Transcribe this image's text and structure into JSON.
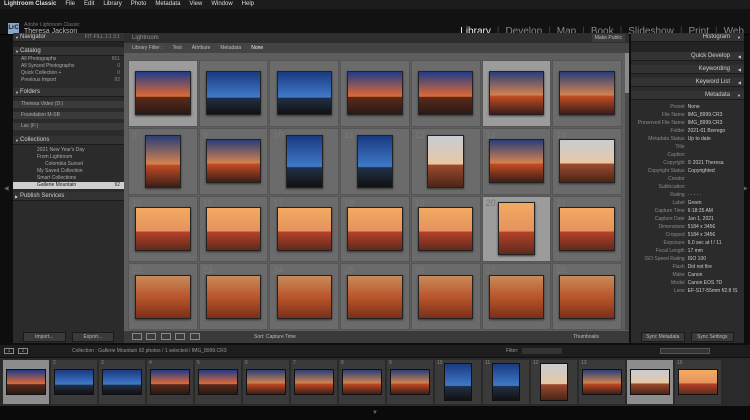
{
  "menubar": {
    "app": "Lightroom Classic",
    "items": [
      "File",
      "Edit",
      "Library",
      "Photo",
      "Metadata",
      "View",
      "Window",
      "Help"
    ]
  },
  "identity": {
    "logo": "LrC",
    "brand": "Adobe Lightroom Classic",
    "user": "Theresa Jackson"
  },
  "modules": [
    "Library",
    "Develop",
    "Map",
    "Book",
    "Slideshow",
    "Print",
    "Web"
  ],
  "active_module": "Library",
  "left_panel": {
    "navigator": {
      "title": "Navigator",
      "zoom": "FIT  FILL  1:1  3:1"
    },
    "catalog": {
      "title": "Catalog",
      "items": [
        {
          "label": "All Photographs",
          "count": "661"
        },
        {
          "label": "All Synced Photographs",
          "count": "0"
        },
        {
          "label": "Quick Collection +",
          "count": "0"
        },
        {
          "label": "Previous Import",
          "count": "92"
        }
      ]
    },
    "folders": {
      "title": "Folders",
      "items": [
        {
          "label": "Theresa Video (D:)",
          "count": ""
        },
        {
          "label": "Foundation M-SB",
          "count": ""
        },
        {
          "label": "Lac (F:)",
          "count": ""
        }
      ]
    },
    "collections": {
      "title": "Collections",
      "items": [
        {
          "label": "2021 New Year's Day",
          "count": ""
        },
        {
          "label": "From Lightroom",
          "count": ""
        },
        {
          "label": "Colombia Sunset",
          "count": ""
        },
        {
          "label": "My Saved Collection",
          "count": ""
        },
        {
          "label": "Smart Collections",
          "count": ""
        },
        {
          "label": "Gallerie Mountain",
          "count": "92"
        }
      ]
    },
    "publish": {
      "title": "Publish Services"
    },
    "import_label": "Import...",
    "export_label": "Export..."
  },
  "center": {
    "title": "Lightroom",
    "make_public": "Make Public",
    "filters": [
      "Library Filter :",
      "Text",
      "Attribute",
      "Metadata",
      "None"
    ],
    "filter_active": "None",
    "sort_label": "Sort:",
    "sort_value": "Capture Time",
    "thumbnails_label": "Thumbnails",
    "cells": [
      {
        "n": "",
        "style": "p-dusk",
        "sel": true
      },
      {
        "n": "",
        "style": "p-blue"
      },
      {
        "n": "",
        "style": "p-blue"
      },
      {
        "n": "",
        "style": "p-dusk"
      },
      {
        "n": "",
        "style": "p-dusk"
      },
      {
        "n": "",
        "style": "p-sunset",
        "sel": true
      },
      {
        "n": "",
        "style": "p-sunset"
      },
      {
        "n": "8",
        "style": "p-sunset",
        "tall": true
      },
      {
        "n": "9",
        "style": "p-sunset"
      },
      {
        "n": "10",
        "style": "p-blue",
        "tall": true
      },
      {
        "n": "11",
        "style": "p-blue",
        "tall": true
      },
      {
        "n": "12",
        "style": "p-pale",
        "tall": true
      },
      {
        "n": "13",
        "style": "p-sunset"
      },
      {
        "n": "14",
        "style": "p-pale"
      },
      {
        "n": "15",
        "style": "p-warm"
      },
      {
        "n": "16",
        "style": "p-warm"
      },
      {
        "n": "17",
        "style": "p-warm"
      },
      {
        "n": "18",
        "style": "p-warm"
      },
      {
        "n": "19",
        "style": "p-warm"
      },
      {
        "n": "20",
        "style": "p-warm",
        "tall": true,
        "sel": true
      },
      {
        "n": "21",
        "style": "p-warm"
      },
      {
        "n": "22",
        "style": "p-rust"
      },
      {
        "n": "23",
        "style": "p-rust"
      },
      {
        "n": "24",
        "style": "p-rust"
      },
      {
        "n": "25",
        "style": "p-rust"
      },
      {
        "n": "26",
        "style": "p-rust"
      },
      {
        "n": "27",
        "style": "p-rust"
      },
      {
        "n": "28",
        "style": "p-rust"
      }
    ]
  },
  "right_panel": {
    "histogram": "Histogram",
    "quick_develop": "Quick Develop",
    "keywording": "Keywording",
    "keyword_list": "Keyword List",
    "metadata": "Metadata",
    "preset_label": "Preset",
    "preset_value": "None",
    "rows": [
      {
        "k": "File Name",
        "v": "IMG_8999.CR3"
      },
      {
        "k": "Preserved File Name",
        "v": "IMG_8999.CR3"
      },
      {
        "k": "Folder",
        "v": "2021-01 Borrego"
      },
      {
        "k": "Metadata Status",
        "v": "Up to date"
      },
      {
        "k": "Title",
        "v": ""
      },
      {
        "k": "Caption",
        "v": ""
      },
      {
        "k": "Copyright",
        "v": "© 2021 Theresa"
      },
      {
        "k": "Copyright Status",
        "v": "Copyrighted"
      },
      {
        "k": "Creator",
        "v": ""
      },
      {
        "k": "Sublocation",
        "v": ""
      },
      {
        "k": "Rating",
        "v": "· · · · ·"
      },
      {
        "k": "Label",
        "v": "Green"
      },
      {
        "k": "Capture Time",
        "v": "6:18:35 AM"
      },
      {
        "k": "Capture Date",
        "v": "Jan 1, 2021"
      },
      {
        "k": "Dimensions",
        "v": "5184 x 3456"
      },
      {
        "k": "Cropped",
        "v": "5184 x 3456"
      },
      {
        "k": "Exposure",
        "v": "6.0 sec at f / 11"
      },
      {
        "k": "Focal Length",
        "v": "17 mm"
      },
      {
        "k": "ISO Speed Rating",
        "v": "ISO 100"
      },
      {
        "k": "Flash",
        "v": "Did not fire"
      },
      {
        "k": "Make",
        "v": "Canon"
      },
      {
        "k": "Model",
        "v": "Canon EOS 7D"
      },
      {
        "k": "Lens",
        "v": "EF-S17-55mm f/2.8 IS"
      }
    ],
    "sync_label": "Sync Metadata",
    "sync_settings_label": "Sync Settings"
  },
  "filmstrip": {
    "pages": [
      "1",
      "2"
    ],
    "source": "Collection : Gallerie Mountain   92 photos / 1 selected / IMG_8999.CR3",
    "filter_label": "Filter:",
    "cells": [
      {
        "n": "1",
        "style": "p-dusk",
        "sel": true
      },
      {
        "n": "2",
        "style": "p-blue"
      },
      {
        "n": "3",
        "style": "p-blue"
      },
      {
        "n": "4",
        "style": "p-dusk"
      },
      {
        "n": "5",
        "style": "p-dusk"
      },
      {
        "n": "6",
        "style": "p-sunset"
      },
      {
        "n": "7",
        "style": "p-sunset"
      },
      {
        "n": "8",
        "style": "p-sunset"
      },
      {
        "n": "9",
        "style": "p-sunset"
      },
      {
        "n": "10",
        "style": "p-blue",
        "tall": true
      },
      {
        "n": "11",
        "style": "p-blue",
        "tall": true
      },
      {
        "n": "12",
        "style": "p-pale",
        "tall": true
      },
      {
        "n": "13",
        "style": "p-sunset"
      },
      {
        "n": "14",
        "style": "p-pale",
        "sel": true
      },
      {
        "n": "15",
        "style": "p-warm"
      }
    ]
  }
}
